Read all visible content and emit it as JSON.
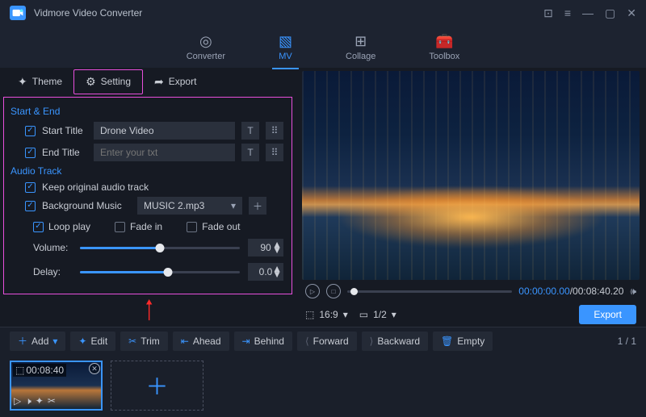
{
  "app": {
    "title": "Vidmore Video Converter"
  },
  "mainnav": {
    "converter": "Converter",
    "mv": "MV",
    "collage": "Collage",
    "toolbox": "Toolbox"
  },
  "tabs": {
    "theme": "Theme",
    "setting": "Setting",
    "export": "Export"
  },
  "settings": {
    "start_end_h": "Start & End",
    "start_title_label": "Start Title",
    "start_title_value": "Drone Video",
    "end_title_label": "End Title",
    "end_title_placeholder": "Enter your txt",
    "audio_h": "Audio Track",
    "keep_audio_label": "Keep original audio track",
    "bgm_label": "Background Music",
    "bgm_value": "MUSIC 2.mp3",
    "loop_label": "Loop play",
    "fadein_label": "Fade in",
    "fadeout_label": "Fade out",
    "volume_label": "Volume:",
    "volume_value": "90",
    "delay_label": "Delay:",
    "delay_value": "0.0"
  },
  "preview": {
    "time_current": "00:00:00.00",
    "time_total": "/00:08:40.20",
    "aspect": "16:9",
    "zoom": "1/2",
    "export_btn": "Export"
  },
  "toolbar": {
    "add": "Add",
    "edit": "Edit",
    "trim": "Trim",
    "ahead": "Ahead",
    "behind": "Behind",
    "forward": "Forward",
    "backward": "Backward",
    "empty": "Empty",
    "page": "1 / 1"
  },
  "thumb": {
    "duration": "00:08:40"
  }
}
